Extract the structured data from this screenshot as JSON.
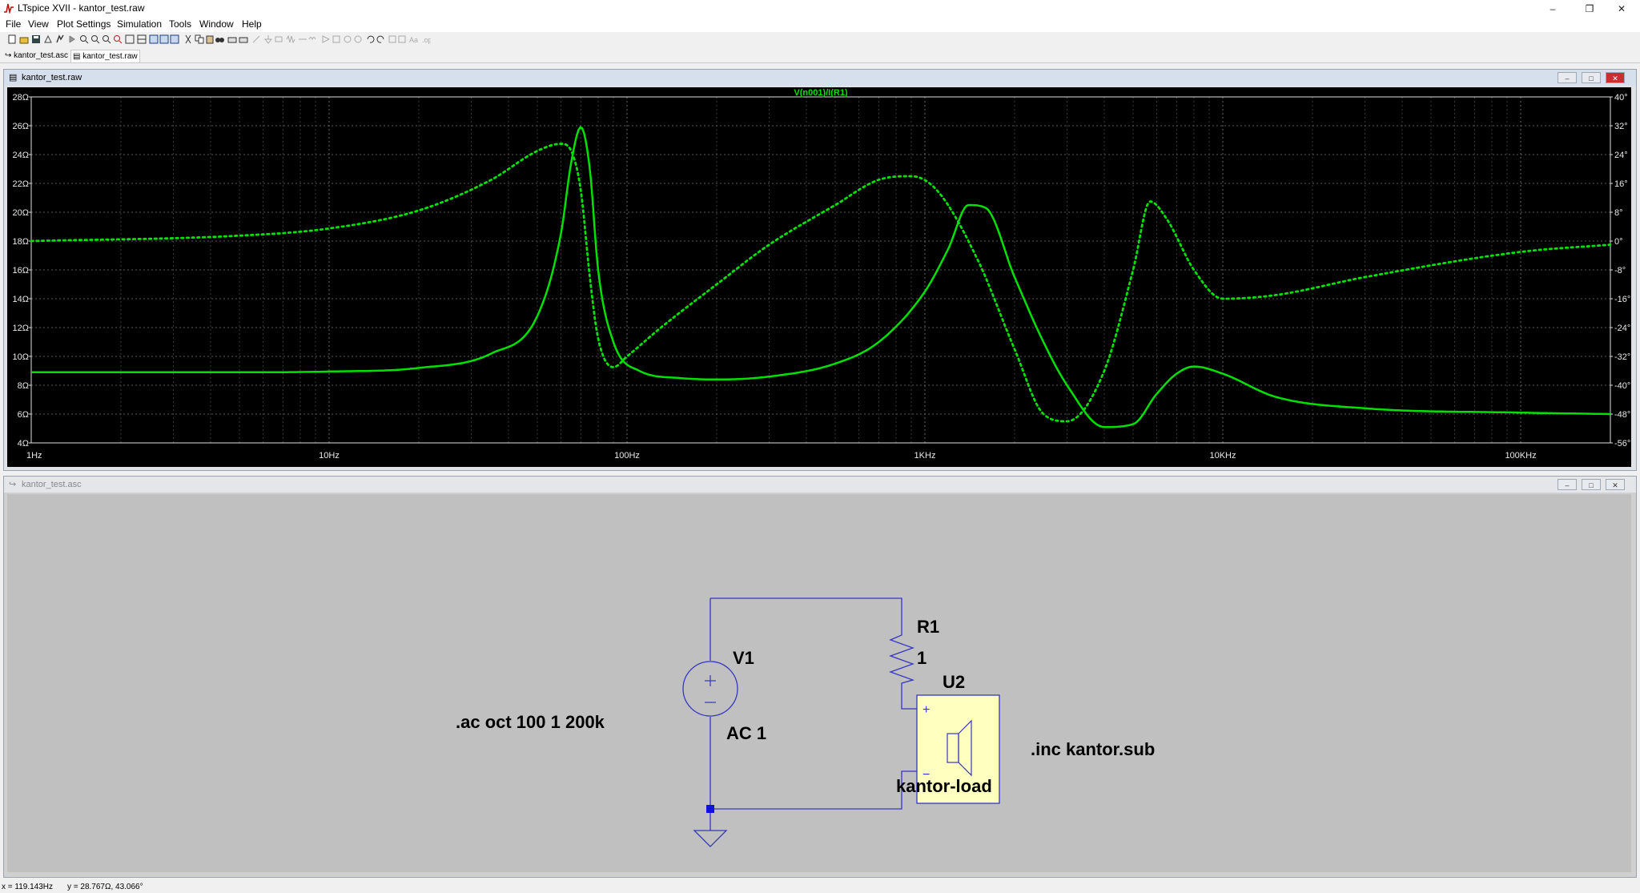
{
  "window": {
    "title": "LTspice XVII - kantor_test.raw",
    "controls": [
      "minimize-icon",
      "restore-icon",
      "close-icon"
    ]
  },
  "menu": [
    "File",
    "View",
    "Plot Settings",
    "Simulation",
    "Tools",
    "Window",
    "Help"
  ],
  "tabs": [
    {
      "label": "kantor_test.asc",
      "icon": "schematic-icon"
    },
    {
      "label": "kantor_test.raw",
      "icon": "waveform-icon"
    }
  ],
  "plot_window": {
    "title": "kantor_test.raw",
    "trace_label": "V(n001)/I(R1)",
    "trace_color": "#00e000",
    "background": "#000000"
  },
  "chart_data": {
    "type": "line",
    "title": "V(n001)/I(R1)",
    "x_scale": "log",
    "xlim": [
      1,
      200000
    ],
    "x_ticks": [
      "1Hz",
      "10Hz",
      "100Hz",
      "1KHz",
      "10KHz",
      "100KHz"
    ],
    "left_axis": {
      "ylim": [
        4,
        28
      ],
      "ticks": [
        "28Ω",
        "26Ω",
        "24Ω",
        "22Ω",
        "20Ω",
        "18Ω",
        "16Ω",
        "14Ω",
        "12Ω",
        "10Ω",
        "8Ω",
        "6Ω",
        "4Ω"
      ]
    },
    "right_axis": {
      "ylim": [
        -56,
        40
      ],
      "ticks": [
        "40°",
        "32°",
        "24°",
        "16°",
        "8°",
        "0°",
        "-8°",
        "-16°",
        "-24°",
        "-32°",
        "-40°",
        "-48°",
        "-56°"
      ]
    },
    "grid": true,
    "series": [
      {
        "style": "solid",
        "axis": "left",
        "x": [
          1,
          5,
          10,
          20,
          35,
          50,
          60,
          65,
          70,
          75,
          80,
          90,
          110,
          150,
          200,
          300,
          500,
          700,
          1000,
          1200,
          1400,
          1600,
          2000,
          2500,
          3000,
          4000,
          5000,
          6000,
          7000,
          8000,
          10000,
          15000,
          30000,
          100000,
          200000
        ],
        "y": [
          8.9,
          8.9,
          8.95,
          9.2,
          10.2,
          12.8,
          18.5,
          23.5,
          25.9,
          23.0,
          16.0,
          11.0,
          9.0,
          8.5,
          8.4,
          8.6,
          9.5,
          11.0,
          14.5,
          17.5,
          20.5,
          20.3,
          15.5,
          11.0,
          8.0,
          5.1,
          5.3,
          7.4,
          8.8,
          9.3,
          8.8,
          7.2,
          6.4,
          6.1,
          6.0
        ]
      },
      {
        "style": "dotted",
        "axis": "right",
        "x": [
          1,
          5,
          10,
          20,
          35,
          50,
          60,
          65,
          70,
          75,
          80,
          90,
          100,
          130,
          200,
          300,
          500,
          700,
          900,
          1100,
          1500,
          2000,
          2500,
          3000,
          4000,
          5000,
          5700,
          6500,
          8000,
          10000,
          15000,
          30000,
          100000,
          200000
        ],
        "y": [
          0,
          1.5,
          3.5,
          8.5,
          17,
          25,
          27,
          25,
          14,
          -10,
          -27,
          -35,
          -32,
          -24,
          -12,
          -1,
          10,
          17,
          18,
          14,
          -5,
          -30,
          -48,
          -50,
          -36,
          -8,
          11,
          6,
          -8,
          -16,
          -15,
          -10,
          -3,
          -1
        ]
      }
    ]
  },
  "schematic_window": {
    "title": "kantor_test.asc",
    "components": {
      "v1_name": "V1",
      "v1_value": "AC 1",
      "r1_name": "R1",
      "r1_value": "1",
      "u2_name": "U2",
      "u2_value": "kantor-load"
    },
    "directives": {
      "ac": ".ac oct 100 1 200k",
      "inc": ".inc kantor.sub"
    },
    "wire_color": "#3636c0"
  },
  "status": {
    "x_readout": "x = 119.143Hz",
    "y_readout": "y = 28.767Ω, 43.066°"
  }
}
